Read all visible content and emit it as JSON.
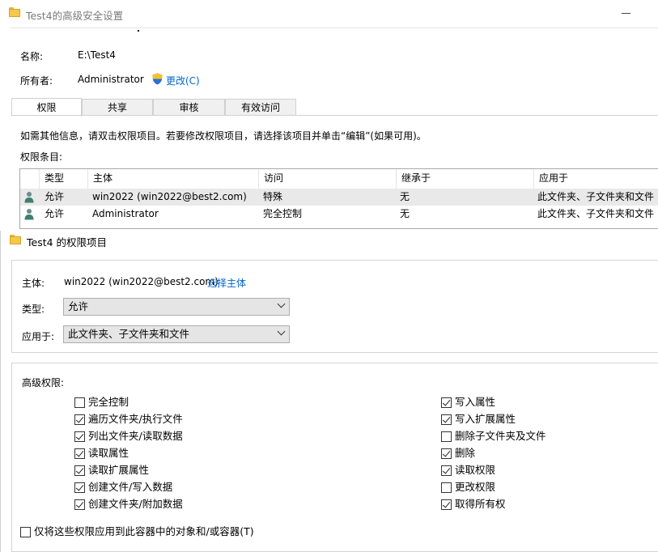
{
  "security_window": {
    "title": "Test4的高级安全设置",
    "name_label": "名称:",
    "name_value": "E:\\Test4",
    "owner_label": "所有者:",
    "owner_value": "Administrator",
    "change_link": "更改(C)",
    "tabs": [
      {
        "label": "权限",
        "active": true
      },
      {
        "label": "共享",
        "active": false
      },
      {
        "label": "审核",
        "active": false
      },
      {
        "label": "有效访问",
        "active": false
      }
    ],
    "info_text": "如需其他信息，请双击权限项目。若要修改权限项目，请选择该项目并单击“编辑”(如果可用)。",
    "entries_label": "权限条目:",
    "table": {
      "columns": [
        "类型",
        "主体",
        "访问",
        "继承于",
        "应用于"
      ],
      "rows": [
        {
          "type": "允许",
          "principal": "win2022 (win2022@best2.com)",
          "access": "特殊",
          "inherited": "无",
          "applies": "此文件夹、子文件夹和文件",
          "selected": true
        },
        {
          "type": "允许",
          "principal": "Administrator",
          "access": "完全控制",
          "inherited": "无",
          "applies": "此文件夹、子文件夹和文件",
          "selected": false
        }
      ]
    }
  },
  "entry_window": {
    "title": "Test4 的权限项目",
    "principal_label": "主体:",
    "principal_value": "win2022 (win2022@best2.com)",
    "select_principal_link": "选择主体",
    "type_label": "类型:",
    "type_value": "允许",
    "applies_label": "应用于:",
    "applies_value": "此文件夹、子文件夹和文件",
    "advanced_label": "高级权限:",
    "left_permissions": [
      {
        "label": "完全控制",
        "checked": false
      },
      {
        "label": "遍历文件夹/执行文件",
        "checked": true
      },
      {
        "label": "列出文件夹/读取数据",
        "checked": true
      },
      {
        "label": "读取属性",
        "checked": true
      },
      {
        "label": "读取扩展属性",
        "checked": true
      },
      {
        "label": "创建文件/写入数据",
        "checked": true
      },
      {
        "label": "创建文件夹/附加数据",
        "checked": true
      }
    ],
    "right_permissions": [
      {
        "label": "写入属性",
        "checked": true
      },
      {
        "label": "写入扩展属性",
        "checked": true
      },
      {
        "label": "删除子文件夹及文件",
        "checked": false
      },
      {
        "label": "删除",
        "checked": true
      },
      {
        "label": "读取权限",
        "checked": true
      },
      {
        "label": "更改权限",
        "checked": false
      },
      {
        "label": "取得所有权",
        "checked": true
      }
    ],
    "container_only_label": "仅将这些权限应用到此容器中的对象和/或容器(T)",
    "container_only_checked": false
  },
  "colors": {
    "link": "#0066cc",
    "selected_row": "#e9e9e9",
    "folder": "#f5c84c"
  }
}
